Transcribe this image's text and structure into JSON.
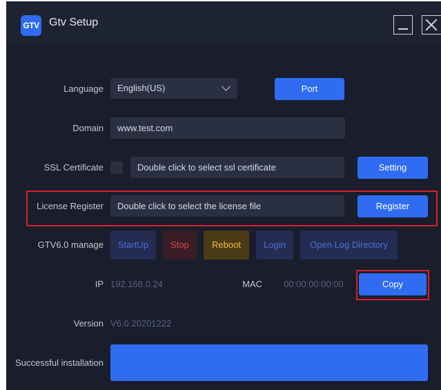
{
  "app": {
    "logo_text": "GTV",
    "title": "Gtv Setup"
  },
  "language": {
    "label": "Language",
    "value": "English(US)",
    "port_button": "Port"
  },
  "domain": {
    "label": "Domain",
    "value": "www.test.com"
  },
  "ssl": {
    "label": "SSL Certificate",
    "placeholder": "Double click to select ssl certificate",
    "button": "Setting"
  },
  "license": {
    "label": "License Register",
    "placeholder": "Double click to select the license file",
    "button": "Register"
  },
  "manage": {
    "label": "GTV6.0 manage",
    "buttons": {
      "startup": "StartUp",
      "stop": "Stop",
      "reboot": "Reboot",
      "login": "Login",
      "open_log": "Open Log Directory"
    }
  },
  "network": {
    "ip_label": "IP",
    "ip_value": "192.168.0.24",
    "mac_label": "MAC",
    "mac_value": "00:00:00:00:00",
    "copy_button": "Copy"
  },
  "version": {
    "label": "Version",
    "value": "V6.0.20201222"
  },
  "status": {
    "label": "Successful installation"
  },
  "colors": {
    "accent": "#2f6cf2",
    "highlight_box": "#d9202c",
    "background": "#191d2c"
  }
}
